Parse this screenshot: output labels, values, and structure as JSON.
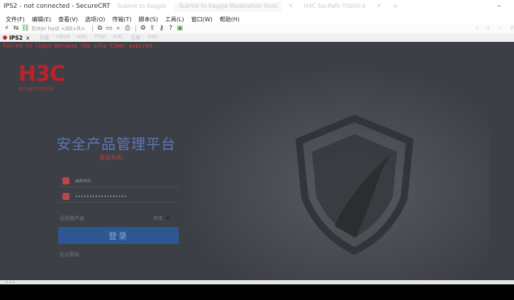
{
  "app": {
    "title": "IPS2 - not connected - SecureCRT"
  },
  "browser_tabs": [
    {
      "label": "Submit to Kaggle",
      "active": false
    },
    {
      "label": "Submit to Kaggle Moderation Tools",
      "active": true
    },
    {
      "label": "H3C SecPath T5000-S",
      "active": false
    }
  ],
  "menu": [
    "文件(F)",
    "编辑(E)",
    "查看(V)",
    "选项(O)",
    "传输(T)",
    "脚本(S)",
    "工具(L)",
    "窗口(W)",
    "帮助(H)"
  ],
  "toolbar": {
    "host_placeholder": "Enter host <Alt+R>"
  },
  "session": {
    "tab_label": "IPS2",
    "close_glyph": "x"
  },
  "bookmarks": [
    "百度",
    "HBV8",
    "H3C",
    "ITSO",
    "H3C",
    "百度",
    "H3C"
  ],
  "terminal": {
    "message": "Failed to login because the idle timer expired."
  },
  "login_page": {
    "logo": "H3C",
    "slogan": "数字化解决方案领导者",
    "title": "安全产品管理平台",
    "error": "登录失败。",
    "username": "admin",
    "password_mask": "••••••••••••••••••",
    "remember_label": "记住用户名",
    "language": "中文",
    "language_arrow": "▼",
    "login_button": "登录",
    "forgot_label": "忘记密码"
  },
  "colors": {
    "terminal_bg": "#3c3f45",
    "terminal_text": "#e23a3a",
    "brand_red": "#c0202a",
    "title_blue": "#5d79b8",
    "button_blue": "#2c5790"
  }
}
